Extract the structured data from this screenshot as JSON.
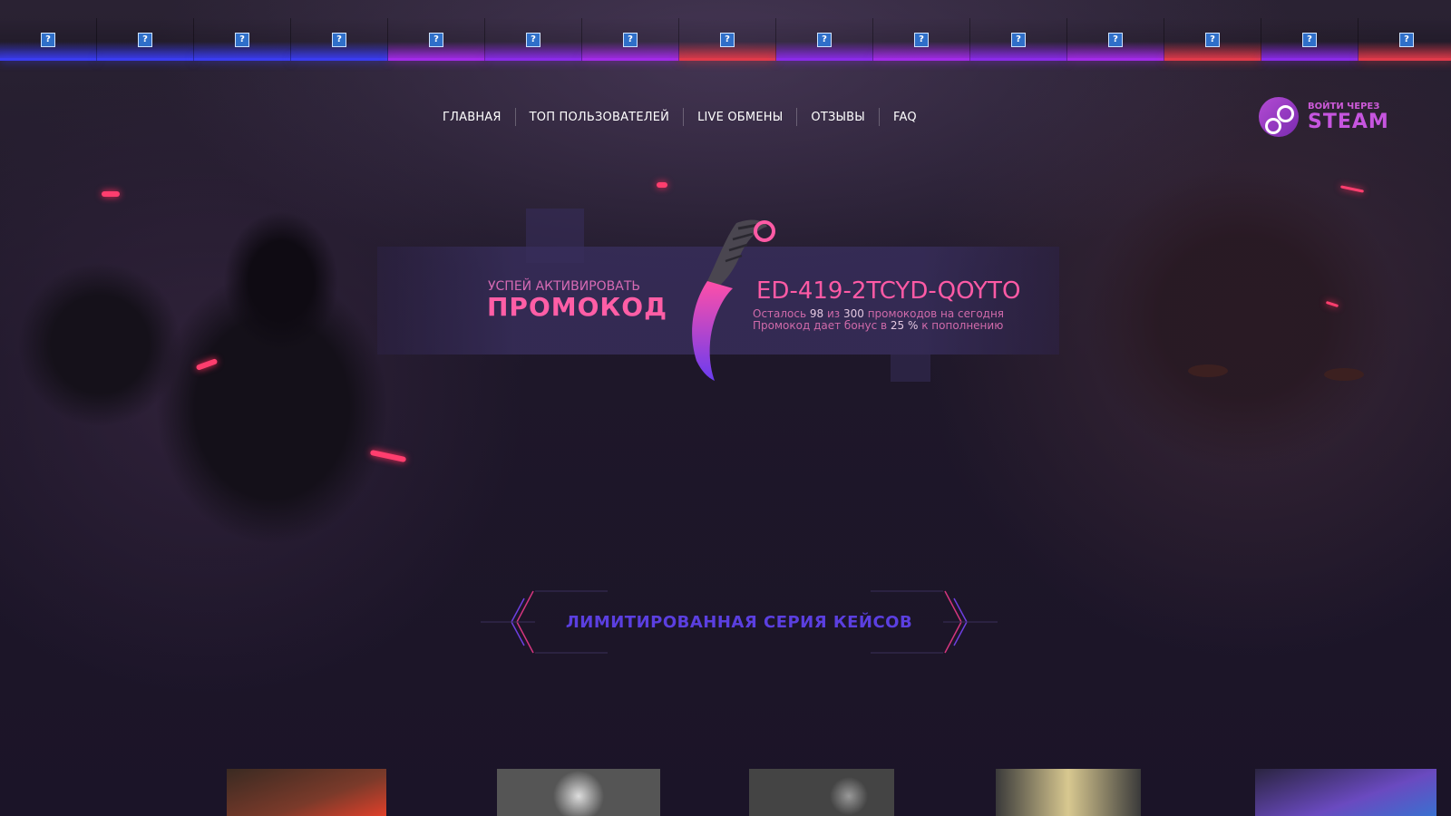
{
  "strip": {
    "item_colors": [
      "#3a3cf0",
      "#3a3cf0",
      "#3a3cf0",
      "#3a3cf0",
      "#a22be8",
      "#8a2be8",
      "#a22be8",
      "#e03a4a",
      "#8a2be8",
      "#a22be8",
      "#8a2be8",
      "#a22be8",
      "#e03a4a",
      "#8a2be8",
      "#e03a4a"
    ],
    "placeholder_glyph": "?"
  },
  "nav": {
    "items": [
      "ГЛАВНАЯ",
      "ТОП ПОЛЬЗОВАТЕЛЕЙ",
      "LIVE ОБМЕНЫ",
      "ОТЗЫВЫ",
      "FAQ"
    ]
  },
  "steam": {
    "line1": "ВОЙТИ ЧЕРЕЗ",
    "line2": "STEAM"
  },
  "promo": {
    "heading_small": "УСПЕЙ АКТИВИРОВАТЬ",
    "heading_big": "ПРОМОКОД",
    "code": "ED-419-2TCYD-QOYTO",
    "line1_prefix": "Осталось ",
    "line1_left": "98",
    "line1_mid": " из ",
    "line1_total": "300",
    "line1_suffix": " промокодов на сегодня",
    "line2_prefix": "Промокод дает бонус в ",
    "line2_value": "25 %",
    "line2_suffix": " к пополнению"
  },
  "section": {
    "title": "ЛИМИТИРОВАННАЯ СЕРИЯ КЕЙСОВ"
  },
  "colors": {
    "accent_pink": "#ff5aa5",
    "accent_purple": "#5b3fe0",
    "background": "#1b1428"
  }
}
